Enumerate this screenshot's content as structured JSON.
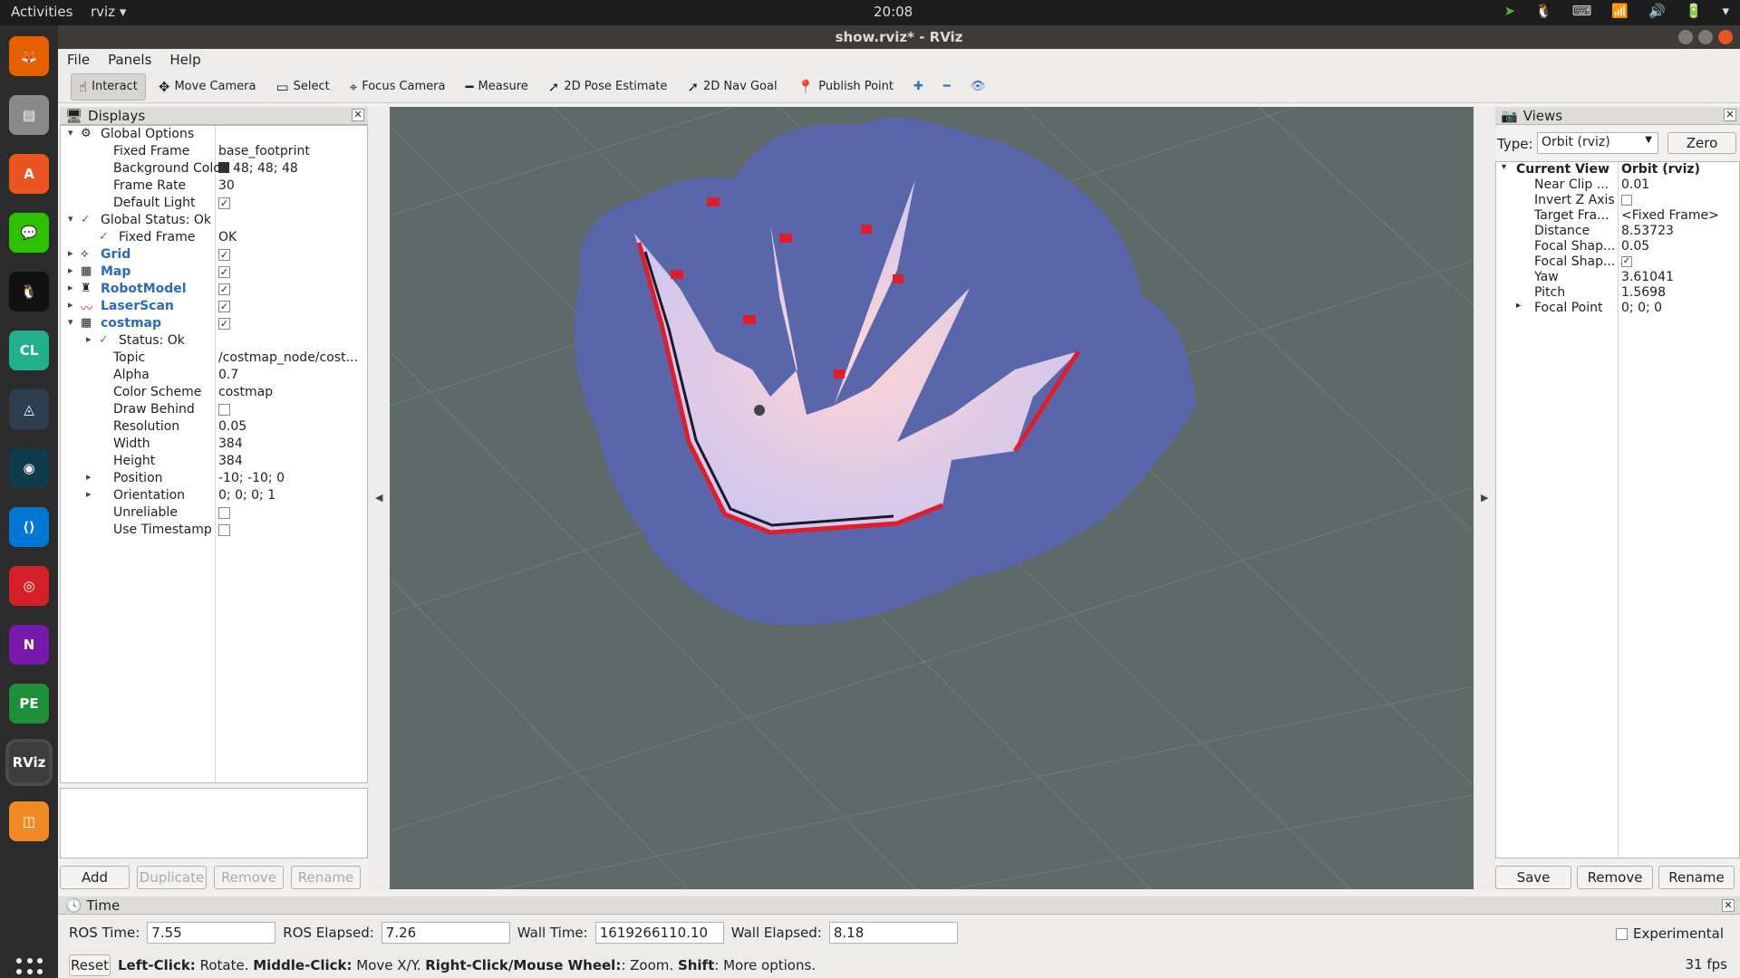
{
  "topbar": {
    "activities": "Activities",
    "app_menu": "rviz ▾",
    "clock": "20:08"
  },
  "dock": {
    "apps": [
      {
        "name": "Firefox",
        "glyph": "🦊",
        "color": "#e66000"
      },
      {
        "name": "Files",
        "glyph": "▤",
        "color": "#8a8a8a"
      },
      {
        "name": "Software",
        "glyph": "A",
        "color": "#e95420"
      },
      {
        "name": "WeChat",
        "glyph": "💬",
        "color": "#2dc100"
      },
      {
        "name": "QQ",
        "glyph": "🐧",
        "color": "#111111"
      },
      {
        "name": "CLion",
        "glyph": "CL",
        "color": "#21b08c"
      },
      {
        "name": "Network",
        "glyph": "◬",
        "color": "#2c3e50"
      },
      {
        "name": "GitKraken",
        "glyph": "◉",
        "color": "#0f3c4a"
      },
      {
        "name": "VS Code",
        "glyph": "⟨⟩",
        "color": "#0078d4"
      },
      {
        "name": "NetEase Music",
        "glyph": "◎",
        "color": "#d5202a"
      },
      {
        "name": "OneNote",
        "glyph": "N",
        "color": "#7719aa"
      },
      {
        "name": "PyCharm",
        "glyph": "PE",
        "color": "#1f8f3a"
      },
      {
        "name": "RViz",
        "glyph": "RViz",
        "color": "#3c3c3c",
        "active": true
      },
      {
        "name": "Layers",
        "glyph": "◫",
        "color": "#f08a24"
      }
    ]
  },
  "window": {
    "title": "show.rviz* - RViz"
  },
  "menu": [
    "File",
    "Panels",
    "Help"
  ],
  "toolbar": {
    "tools": [
      {
        "label": "Interact",
        "icon": "☝",
        "active": true
      },
      {
        "label": "Move Camera",
        "icon": "✥"
      },
      {
        "label": "Select",
        "icon": "▭"
      },
      {
        "label": "Focus Camera",
        "icon": "⌖"
      },
      {
        "label": "Measure",
        "icon": "━"
      },
      {
        "label": "2D Pose Estimate",
        "icon": "➚"
      },
      {
        "label": "2D Nav Goal",
        "icon": "➚"
      },
      {
        "label": "Publish Point",
        "icon": "📍"
      }
    ],
    "extra_icons": [
      "✚",
      "━",
      "👁"
    ]
  },
  "displays": {
    "title": "Displays",
    "rows": [
      {
        "indent": 0,
        "arrow": "▾",
        "icon": "⚙",
        "label": "Global Options"
      },
      {
        "indent": 1,
        "label": "Fixed Frame",
        "value": "base_footprint"
      },
      {
        "indent": 1,
        "label": "Background Color",
        "value": "48; 48; 48",
        "swatch": "#303030"
      },
      {
        "indent": 1,
        "label": "Frame Rate",
        "value": "30"
      },
      {
        "indent": 1,
        "label": "Default Light",
        "checkbox": true
      },
      {
        "indent": 0,
        "arrow": "▾",
        "icon": "✓",
        "icon_class": "green",
        "label": "Global Status: Ok"
      },
      {
        "indent": 1,
        "icon": "✓",
        "icon_class": "green",
        "label": "Fixed Frame",
        "value": "OK"
      },
      {
        "indent": 0,
        "arrow": "▸",
        "icon": "⟡",
        "label": "Grid",
        "blue": true,
        "checkbox": true
      },
      {
        "indent": 0,
        "arrow": "▸",
        "icon": "▦",
        "label": "Map",
        "blue": true,
        "checkbox": true
      },
      {
        "indent": 0,
        "arrow": "▸",
        "icon": "♜",
        "label": "RobotModel",
        "blue": true,
        "checkbox": true
      },
      {
        "indent": 0,
        "arrow": "▸",
        "icon": "〰",
        "icon_class": "red",
        "label": "LaserScan",
        "blue": true,
        "checkbox": true
      },
      {
        "indent": 0,
        "arrow": "▾",
        "icon": "▦",
        "label": "costmap",
        "blue": true,
        "checkbox": true
      },
      {
        "indent": 1,
        "arrow": "▸",
        "icon": "✓",
        "icon_class": "green",
        "label": "Status: Ok"
      },
      {
        "indent": 1,
        "label": "Topic",
        "value": "/costmap_node/cost..."
      },
      {
        "indent": 1,
        "label": "Alpha",
        "value": "0.7"
      },
      {
        "indent": 1,
        "label": "Color Scheme",
        "value": "costmap"
      },
      {
        "indent": 1,
        "label": "Draw Behind",
        "checkbox": false
      },
      {
        "indent": 1,
        "label": "Resolution",
        "value": "0.05"
      },
      {
        "indent": 1,
        "label": "Width",
        "value": "384"
      },
      {
        "indent": 1,
        "label": "Height",
        "value": "384"
      },
      {
        "indent": 1,
        "arrow": "▸",
        "label": "Position",
        "value": "-10; -10; 0"
      },
      {
        "indent": 1,
        "arrow": "▸",
        "label": "Orientation",
        "value": "0; 0; 0; 1"
      },
      {
        "indent": 1,
        "label": "Unreliable",
        "checkbox": false
      },
      {
        "indent": 1,
        "label": "Use Timestamp",
        "checkbox": false
      }
    ],
    "buttons": [
      {
        "label": "Add",
        "enabled": true
      },
      {
        "label": "Duplicate",
        "enabled": false
      },
      {
        "label": "Remove",
        "enabled": false
      },
      {
        "label": "Rename",
        "enabled": false
      }
    ]
  },
  "views": {
    "title": "Views",
    "type_label": "Type:",
    "type_value": "Orbit (rviz)",
    "zero_label": "Zero",
    "rows": [
      {
        "indent": 0,
        "arrow": "▾",
        "label": "Current View",
        "value": "Orbit (rviz)",
        "bold": true
      },
      {
        "indent": 1,
        "label": "Near Clip ...",
        "value": "0.01"
      },
      {
        "indent": 1,
        "label": "Invert Z Axis",
        "checkbox": false
      },
      {
        "indent": 1,
        "label": "Target Fra...",
        "value": "<Fixed Frame>"
      },
      {
        "indent": 1,
        "label": "Distance",
        "value": "8.53723"
      },
      {
        "indent": 1,
        "label": "Focal Shap...",
        "value": "0.05"
      },
      {
        "indent": 1,
        "label": "Focal Shap...",
        "checkbox": true
      },
      {
        "indent": 1,
        "label": "Yaw",
        "value": "3.61041"
      },
      {
        "indent": 1,
        "label": "Pitch",
        "value": "1.5698"
      },
      {
        "indent": 1,
        "arrow": "▸",
        "label": "Focal Point",
        "value": "0; 0; 0"
      }
    ],
    "buttons": [
      "Save",
      "Remove",
      "Rename"
    ]
  },
  "time": {
    "title": "Time",
    "ros_time_label": "ROS Time:",
    "ros_time": "7.55",
    "ros_elapsed_label": "ROS Elapsed:",
    "ros_elapsed": "7.26",
    "wall_time_label": "Wall Time:",
    "wall_time": "1619266110.10",
    "wall_elapsed_label": "Wall Elapsed:",
    "wall_elapsed": "8.18",
    "experimental_label": "Experimental",
    "reset_label": "Reset",
    "hint_parts": [
      {
        "text": "Left-Click:",
        "bold": true
      },
      {
        "text": " Rotate. ",
        "bold": false
      },
      {
        "text": "Middle-Click:",
        "bold": true
      },
      {
        "text": " Move X/Y. ",
        "bold": false
      },
      {
        "text": "Right-Click/Mouse Wheel:",
        "bold": true
      },
      {
        "text": ": Zoom. ",
        "bold": false
      },
      {
        "text": "Shift",
        "bold": true
      },
      {
        "text": ": More options.",
        "bold": false
      }
    ],
    "fps": "31 fps"
  }
}
